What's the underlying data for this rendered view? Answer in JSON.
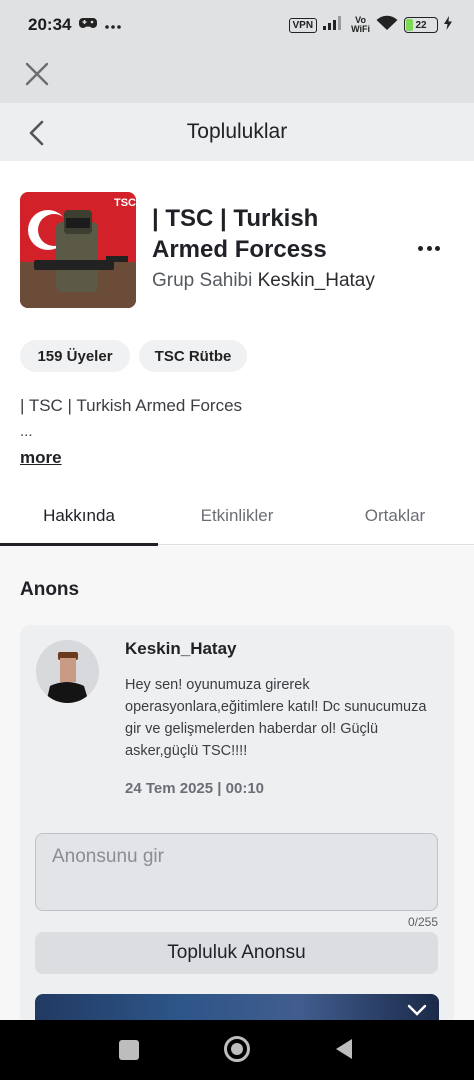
{
  "status_bar": {
    "time": "20:34",
    "left_icons": [
      "game-controller-icon",
      "more-horizontal-icon"
    ],
    "vpn": "VPN",
    "vowifi_top": "Vo",
    "vowifi_bottom": "WiFi",
    "battery": "22",
    "battery_color": "#7ed957"
  },
  "nav": {
    "title": "Topluluklar"
  },
  "group": {
    "logo_text": "TSC",
    "name": "| TSC | Turkish Armed Forcess",
    "owner_label": "Grup Sahibi",
    "owner_name": "Keskin_Hatay",
    "members_pill": "159 Üyeler",
    "rank_pill": "TSC Rütbe",
    "description": "| TSC | Turkish Armed Forces",
    "description_more": "...",
    "more_link": "more"
  },
  "tabs": [
    {
      "label": "Hakkında",
      "active": true
    },
    {
      "label": "Etkinlikler",
      "active": false
    },
    {
      "label": "Ortaklar",
      "active": false
    }
  ],
  "announcement": {
    "section_title": "Anons",
    "author": "Keskin_Hatay",
    "body": "Hey sen! oyunumuza girerek operasyonlara,eğitimlere katıl! Dc sunucumuza gir ve gelişmelerden haberdar ol! Güçlü asker,güçlü TSC!!!!",
    "date": "24 Tem 2025 | 00:10",
    "input_placeholder": "Anonsunu gir",
    "char_count": "0/255",
    "button_label": "Topluluk Anonsu"
  },
  "colors": {
    "topbar": "#dfe1e3",
    "navbar": "#eceef0",
    "flag_red": "#d3212a",
    "text_primary": "#1f2126"
  }
}
